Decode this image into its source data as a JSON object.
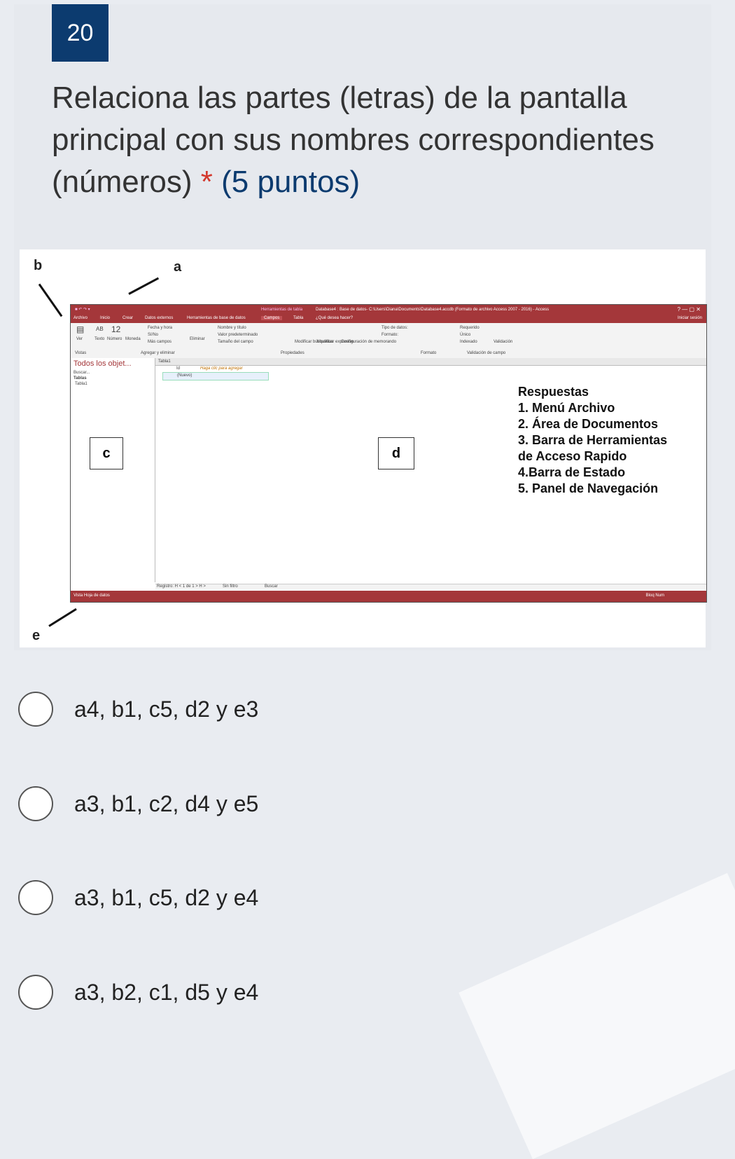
{
  "question": {
    "number": "20",
    "title": "Relaciona las partes (letras) de  la pantalla principal con sus nombres correspondientes (números)",
    "required_mark": "*",
    "points": "(5 puntos)"
  },
  "figure": {
    "letters": {
      "a": "a",
      "b": "b",
      "c": "c",
      "d": "d",
      "e": "e"
    },
    "access": {
      "window_title": "Database4 : Base de datos- C:\\Users\\Diana\\Documents\\Database4.accdb (Formato de archivo Access 2007 - 2016) - Access",
      "tools_label": "Herramientas de tabla",
      "tabs": [
        "Archivo",
        "Inicio",
        "Crear",
        "Datos externos",
        "Herramientas de base de datos",
        "Campos",
        "Tabla",
        "¿Qué desea hacer?"
      ],
      "signin": "Iniciar sesión",
      "ribbon_items": [
        "AB",
        "12",
        "Ver",
        "Texto",
        "Número",
        "Moneda",
        "Fecha y hora",
        "Sí/No",
        "Más campos",
        "Eliminar",
        "Nombre y título",
        "Valor predeterminado",
        "Tamaño del campo",
        "Modificar búsquedas",
        "Modificar expresión",
        "Configuración de memorando",
        "Tipo de datos:",
        "Formato:",
        "Requerido",
        "Único",
        "Indexado",
        "Validación"
      ],
      "groups": [
        "Vistas",
        "Agregar y eliminar",
        "Propiedades",
        "Formato",
        "Validación de campo"
      ],
      "nav_title": "Todos los objet...",
      "nav_search": "Buscar...",
      "nav_section": "Tablas",
      "nav_item": "Tabla1",
      "doc_tab": "Tabla1",
      "col_id": "Id",
      "col_add": "Haga clic para agregar",
      "new_row": "(Nuevo)",
      "record_nav": "Registro: H < 1 de 1 > H >",
      "filter": "Sin filtro",
      "search": "Buscar",
      "status_left": "Vista Hoja de datos",
      "status_right": "Bloq Num"
    },
    "answers_title": "Respuestas",
    "answers": [
      "1. Menú Archivo",
      "2. Área de Documentos",
      "3. Barra de Herramientas",
      "de Acceso Rapido",
      "4.Barra de Estado",
      "5. Panel de Navegación"
    ]
  },
  "options": [
    {
      "label": "a4, b1, c5, d2 y e3"
    },
    {
      "label": "a3, b1, c2, d4 y e5"
    },
    {
      "label": "a3, b1, c5, d2 y e4"
    },
    {
      "label": "a3, b2, c1, d5 y e4"
    }
  ]
}
